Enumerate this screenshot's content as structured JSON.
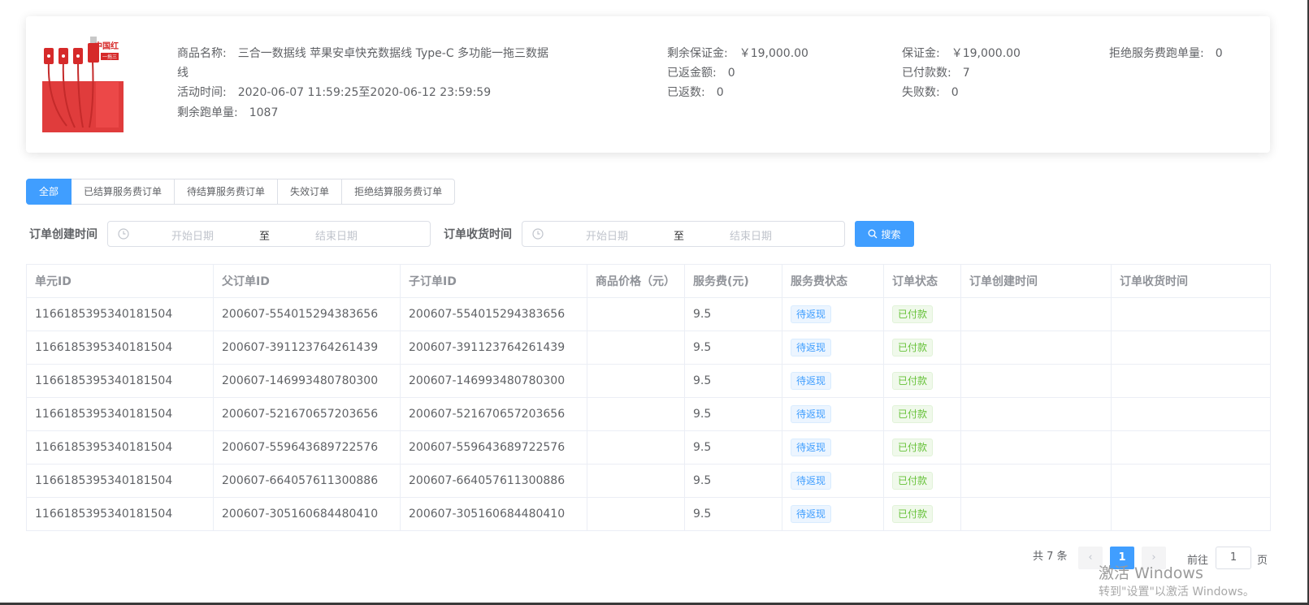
{
  "product": {
    "name_label": "商品名称:",
    "name_value_line1": "三合一数据线 苹果安卓快充数据线 Type-C 多功能一拖三数据",
    "name_value_line2": "线",
    "activity_label": "活动时间:",
    "activity_value": "2020-06-07 11:59:25至2020-06-12 23:59:59",
    "remaining_label": "剩余跑单量:",
    "remaining_value": "1087",
    "thumb_brand": "中国红",
    "thumb_sub": "一拖三",
    "stats_col1": [
      {
        "label": "剩余保证金:",
        "value": "￥19,000.00"
      },
      {
        "label": "已返金额:",
        "value": "0"
      },
      {
        "label": "已返数:",
        "value": "0"
      }
    ],
    "stats_col2": [
      {
        "label": "保证金:",
        "value": "￥19,000.00"
      },
      {
        "label": "已付款数:",
        "value": "7"
      },
      {
        "label": "失败数:",
        "value": "0"
      }
    ],
    "stats_col3": [
      {
        "label": "拒绝服务费跑单量:",
        "value": "0"
      }
    ]
  },
  "tabs": [
    {
      "label": "全部",
      "active": true
    },
    {
      "label": "已结算服务费订单",
      "active": false
    },
    {
      "label": "待结算服务费订单",
      "active": false
    },
    {
      "label": "失效订单",
      "active": false
    },
    {
      "label": "拒绝结算服务费订单",
      "active": false
    }
  ],
  "filters": {
    "created_label": "订单创建时间",
    "received_label": "订单收货时间",
    "start_placeholder": "开始日期",
    "end_placeholder": "结束日期",
    "range_separator": "至",
    "search_label": "搜索"
  },
  "table": {
    "headers": [
      "单元ID",
      "父订单ID",
      "子订单ID",
      "商品价格（元）",
      "服务费(元)",
      "服务费状态",
      "订单状态",
      "订单创建时间",
      "订单收货时间"
    ],
    "rows": [
      {
        "unit_id": "1166185395340181504",
        "parent_id": "200607-554015294383656",
        "child_id": "200607-554015294383656",
        "price": "",
        "fee": "9.5",
        "fee_status": "待返现",
        "order_status": "已付款",
        "created": "",
        "received": ""
      },
      {
        "unit_id": "1166185395340181504",
        "parent_id": "200607-391123764261439",
        "child_id": "200607-391123764261439",
        "price": "",
        "fee": "9.5",
        "fee_status": "待返现",
        "order_status": "已付款",
        "created": "",
        "received": ""
      },
      {
        "unit_id": "1166185395340181504",
        "parent_id": "200607-146993480780300",
        "child_id": "200607-146993480780300",
        "price": "",
        "fee": "9.5",
        "fee_status": "待返现",
        "order_status": "已付款",
        "created": "",
        "received": ""
      },
      {
        "unit_id": "1166185395340181504",
        "parent_id": "200607-521670657203656",
        "child_id": "200607-521670657203656",
        "price": "",
        "fee": "9.5",
        "fee_status": "待返现",
        "order_status": "已付款",
        "created": "",
        "received": ""
      },
      {
        "unit_id": "1166185395340181504",
        "parent_id": "200607-559643689722576",
        "child_id": "200607-559643689722576",
        "price": "",
        "fee": "9.5",
        "fee_status": "待返现",
        "order_status": "已付款",
        "created": "",
        "received": ""
      },
      {
        "unit_id": "1166185395340181504",
        "parent_id": "200607-664057611300886",
        "child_id": "200607-664057611300886",
        "price": "",
        "fee": "9.5",
        "fee_status": "待返现",
        "order_status": "已付款",
        "created": "",
        "received": ""
      },
      {
        "unit_id": "1166185395340181504",
        "parent_id": "200607-305160684480410",
        "child_id": "200607-305160684480410",
        "price": "",
        "fee": "9.5",
        "fee_status": "待返现",
        "order_status": "已付款",
        "created": "",
        "received": ""
      }
    ]
  },
  "pagination": {
    "total_text": "共 7 条",
    "prev": "‹",
    "current_page": "1",
    "next": "›",
    "goto_label": "前往",
    "goto_value": "1",
    "page_suffix": "页"
  },
  "watermark": {
    "line1": "激活 Windows",
    "line2": "转到\"设置\"以激活 Windows。"
  },
  "colors": {
    "primary": "#409eff",
    "success": "#67c23a"
  }
}
